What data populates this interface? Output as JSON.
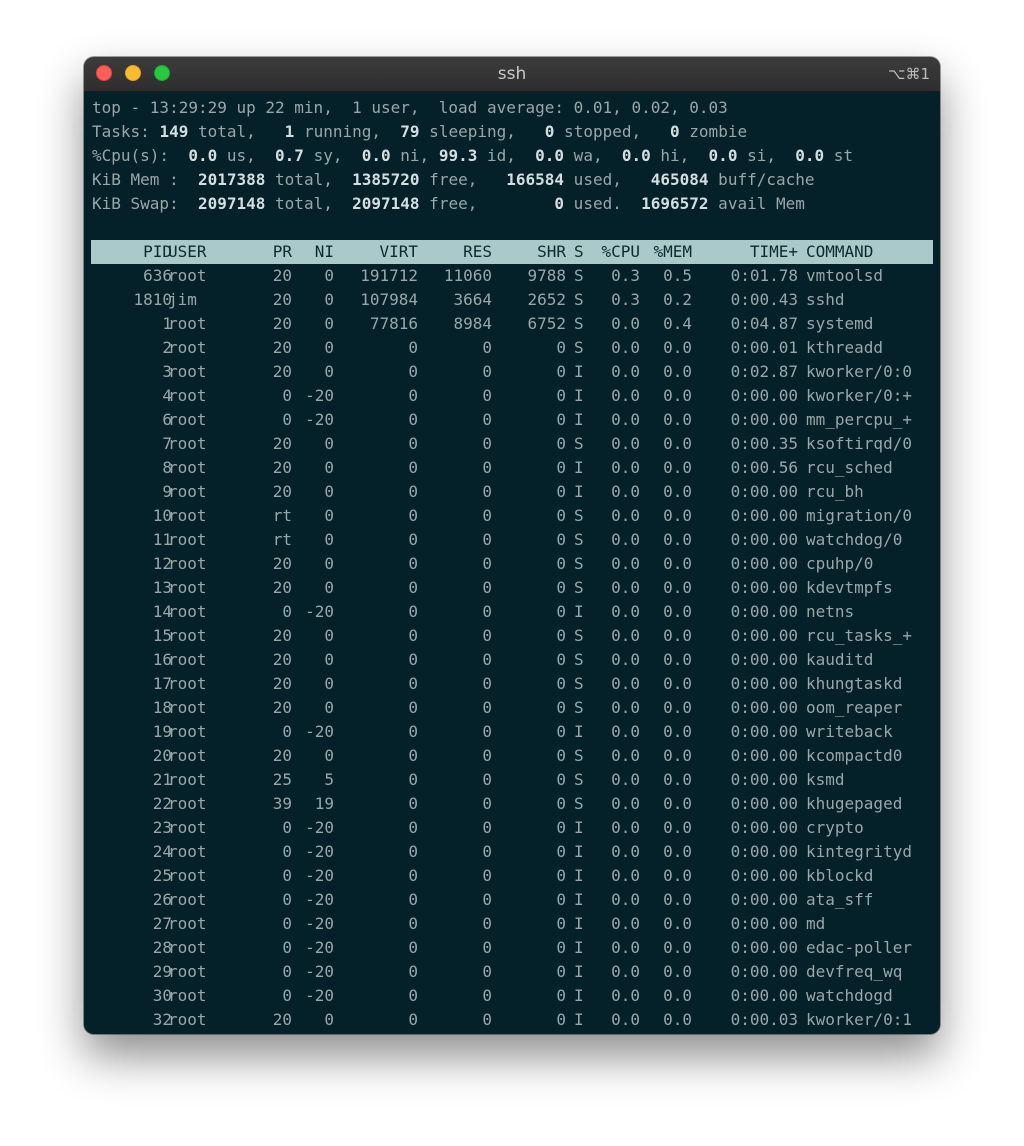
{
  "window": {
    "title": "ssh",
    "shortcut": "⌥⌘1"
  },
  "summary": [
    [
      {
        "t": "top - 13:29:29 up 22 min,  1 user,  load average: 0.01, 0.02, 0.03",
        "b": false
      }
    ],
    [
      {
        "t": "Tasks: ",
        "b": false
      },
      {
        "t": "149",
        "b": true
      },
      {
        "t": " total,   ",
        "b": false
      },
      {
        "t": "1",
        "b": true
      },
      {
        "t": " running,  ",
        "b": false
      },
      {
        "t": "79",
        "b": true
      },
      {
        "t": " sleeping,   ",
        "b": false
      },
      {
        "t": "0",
        "b": true
      },
      {
        "t": " stopped,   ",
        "b": false
      },
      {
        "t": "0",
        "b": true
      },
      {
        "t": " zombie",
        "b": false
      }
    ],
    [
      {
        "t": "%Cpu(s):  ",
        "b": false
      },
      {
        "t": "0.0",
        "b": true
      },
      {
        "t": " us,  ",
        "b": false
      },
      {
        "t": "0.7",
        "b": true
      },
      {
        "t": " sy,  ",
        "b": false
      },
      {
        "t": "0.0",
        "b": true
      },
      {
        "t": " ni, ",
        "b": false
      },
      {
        "t": "99.3",
        "b": true
      },
      {
        "t": " id,  ",
        "b": false
      },
      {
        "t": "0.0",
        "b": true
      },
      {
        "t": " wa,  ",
        "b": false
      },
      {
        "t": "0.0",
        "b": true
      },
      {
        "t": " hi,  ",
        "b": false
      },
      {
        "t": "0.0",
        "b": true
      },
      {
        "t": " si,  ",
        "b": false
      },
      {
        "t": "0.0",
        "b": true
      },
      {
        "t": " st",
        "b": false
      }
    ],
    [
      {
        "t": "KiB Mem :  ",
        "b": false
      },
      {
        "t": "2017388",
        "b": true
      },
      {
        "t": " total,  ",
        "b": false
      },
      {
        "t": "1385720",
        "b": true
      },
      {
        "t": " free,   ",
        "b": false
      },
      {
        "t": "166584",
        "b": true
      },
      {
        "t": " used,   ",
        "b": false
      },
      {
        "t": "465084",
        "b": true
      },
      {
        "t": " buff/cache",
        "b": false
      }
    ],
    [
      {
        "t": "KiB Swap:  ",
        "b": false
      },
      {
        "t": "2097148",
        "b": true
      },
      {
        "t": " total,  ",
        "b": false
      },
      {
        "t": "2097148",
        "b": true
      },
      {
        "t": " free,        ",
        "b": false
      },
      {
        "t": "0",
        "b": true
      },
      {
        "t": " used.  ",
        "b": false
      },
      {
        "t": "1696572",
        "b": true
      },
      {
        "t": " avail Mem",
        "b": false
      }
    ]
  ],
  "table": {
    "columns": [
      "PID",
      "USER",
      "PR",
      "NI",
      "VIRT",
      "RES",
      "SHR",
      "S",
      "%CPU",
      "%MEM",
      "TIME+",
      "COMMAND"
    ],
    "rows": [
      [
        "636",
        "root",
        "20",
        "0",
        "191712",
        "11060",
        "9788",
        "S",
        "0.3",
        "0.5",
        "0:01.78",
        "vmtoolsd"
      ],
      [
        "1810",
        "jim",
        "20",
        "0",
        "107984",
        "3664",
        "2652",
        "S",
        "0.3",
        "0.2",
        "0:00.43",
        "sshd"
      ],
      [
        "1",
        "root",
        "20",
        "0",
        "77816",
        "8984",
        "6752",
        "S",
        "0.0",
        "0.4",
        "0:04.87",
        "systemd"
      ],
      [
        "2",
        "root",
        "20",
        "0",
        "0",
        "0",
        "0",
        "S",
        "0.0",
        "0.0",
        "0:00.01",
        "kthreadd"
      ],
      [
        "3",
        "root",
        "20",
        "0",
        "0",
        "0",
        "0",
        "I",
        "0.0",
        "0.0",
        "0:02.87",
        "kworker/0:0"
      ],
      [
        "4",
        "root",
        "0",
        "-20",
        "0",
        "0",
        "0",
        "I",
        "0.0",
        "0.0",
        "0:00.00",
        "kworker/0:+"
      ],
      [
        "6",
        "root",
        "0",
        "-20",
        "0",
        "0",
        "0",
        "I",
        "0.0",
        "0.0",
        "0:00.00",
        "mm_percpu_+"
      ],
      [
        "7",
        "root",
        "20",
        "0",
        "0",
        "0",
        "0",
        "S",
        "0.0",
        "0.0",
        "0:00.35",
        "ksoftirqd/0"
      ],
      [
        "8",
        "root",
        "20",
        "0",
        "0",
        "0",
        "0",
        "I",
        "0.0",
        "0.0",
        "0:00.56",
        "rcu_sched"
      ],
      [
        "9",
        "root",
        "20",
        "0",
        "0",
        "0",
        "0",
        "I",
        "0.0",
        "0.0",
        "0:00.00",
        "rcu_bh"
      ],
      [
        "10",
        "root",
        "rt",
        "0",
        "0",
        "0",
        "0",
        "S",
        "0.0",
        "0.0",
        "0:00.00",
        "migration/0"
      ],
      [
        "11",
        "root",
        "rt",
        "0",
        "0",
        "0",
        "0",
        "S",
        "0.0",
        "0.0",
        "0:00.00",
        "watchdog/0"
      ],
      [
        "12",
        "root",
        "20",
        "0",
        "0",
        "0",
        "0",
        "S",
        "0.0",
        "0.0",
        "0:00.00",
        "cpuhp/0"
      ],
      [
        "13",
        "root",
        "20",
        "0",
        "0",
        "0",
        "0",
        "S",
        "0.0",
        "0.0",
        "0:00.00",
        "kdevtmpfs"
      ],
      [
        "14",
        "root",
        "0",
        "-20",
        "0",
        "0",
        "0",
        "I",
        "0.0",
        "0.0",
        "0:00.00",
        "netns"
      ],
      [
        "15",
        "root",
        "20",
        "0",
        "0",
        "0",
        "0",
        "S",
        "0.0",
        "0.0",
        "0:00.00",
        "rcu_tasks_+"
      ],
      [
        "16",
        "root",
        "20",
        "0",
        "0",
        "0",
        "0",
        "S",
        "0.0",
        "0.0",
        "0:00.00",
        "kauditd"
      ],
      [
        "17",
        "root",
        "20",
        "0",
        "0",
        "0",
        "0",
        "S",
        "0.0",
        "0.0",
        "0:00.00",
        "khungtaskd"
      ],
      [
        "18",
        "root",
        "20",
        "0",
        "0",
        "0",
        "0",
        "S",
        "0.0",
        "0.0",
        "0:00.00",
        "oom_reaper"
      ],
      [
        "19",
        "root",
        "0",
        "-20",
        "0",
        "0",
        "0",
        "I",
        "0.0",
        "0.0",
        "0:00.00",
        "writeback"
      ],
      [
        "20",
        "root",
        "20",
        "0",
        "0",
        "0",
        "0",
        "S",
        "0.0",
        "0.0",
        "0:00.00",
        "kcompactd0"
      ],
      [
        "21",
        "root",
        "25",
        "5",
        "0",
        "0",
        "0",
        "S",
        "0.0",
        "0.0",
        "0:00.00",
        "ksmd"
      ],
      [
        "22",
        "root",
        "39",
        "19",
        "0",
        "0",
        "0",
        "S",
        "0.0",
        "0.0",
        "0:00.00",
        "khugepaged"
      ],
      [
        "23",
        "root",
        "0",
        "-20",
        "0",
        "0",
        "0",
        "I",
        "0.0",
        "0.0",
        "0:00.00",
        "crypto"
      ],
      [
        "24",
        "root",
        "0",
        "-20",
        "0",
        "0",
        "0",
        "I",
        "0.0",
        "0.0",
        "0:00.00",
        "kintegrityd"
      ],
      [
        "25",
        "root",
        "0",
        "-20",
        "0",
        "0",
        "0",
        "I",
        "0.0",
        "0.0",
        "0:00.00",
        "kblockd"
      ],
      [
        "26",
        "root",
        "0",
        "-20",
        "0",
        "0",
        "0",
        "I",
        "0.0",
        "0.0",
        "0:00.00",
        "ata_sff"
      ],
      [
        "27",
        "root",
        "0",
        "-20",
        "0",
        "0",
        "0",
        "I",
        "0.0",
        "0.0",
        "0:00.00",
        "md"
      ],
      [
        "28",
        "root",
        "0",
        "-20",
        "0",
        "0",
        "0",
        "I",
        "0.0",
        "0.0",
        "0:00.00",
        "edac-poller"
      ],
      [
        "29",
        "root",
        "0",
        "-20",
        "0",
        "0",
        "0",
        "I",
        "0.0",
        "0.0",
        "0:00.00",
        "devfreq_wq"
      ],
      [
        "30",
        "root",
        "0",
        "-20",
        "0",
        "0",
        "0",
        "I",
        "0.0",
        "0.0",
        "0:00.00",
        "watchdogd"
      ],
      [
        "32",
        "root",
        "20",
        "0",
        "0",
        "0",
        "0",
        "I",
        "0.0",
        "0.0",
        "0:00.03",
        "kworker/0:1"
      ]
    ]
  },
  "colors": {
    "background": "#042029",
    "text": "#9aa7a8",
    "bold_text": "#d5dedf",
    "header_bar": "#a9cac8",
    "header_text": "#0b2b33"
  }
}
